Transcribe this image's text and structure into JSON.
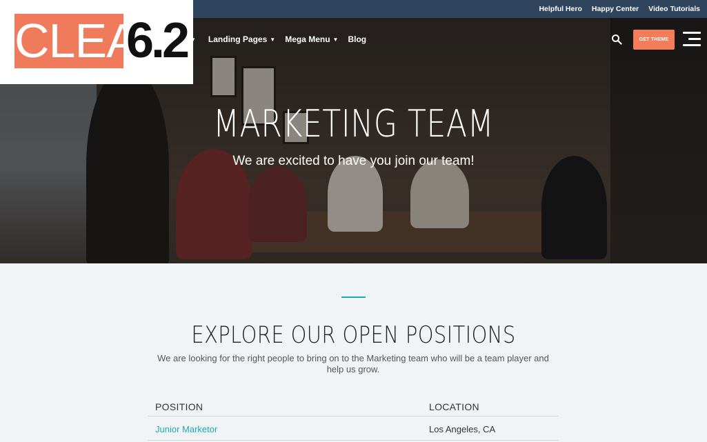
{
  "logo": {
    "word": "CLEAN",
    "version": "6.2"
  },
  "topbar": {
    "links": [
      "Helpful Hero",
      "Happy Center",
      "Video Tutorials"
    ]
  },
  "nav": {
    "items": [
      {
        "label": "Landing Pages"
      },
      {
        "label": "Mega Menu"
      },
      {
        "label": "Blog"
      }
    ],
    "cta_label": "GET THEME",
    "search_icon": "search-icon",
    "menu_icon": "hamburger-icon"
  },
  "hero": {
    "title": "MARKETING TEAM",
    "subtitle": "We are excited to have you join our team!"
  },
  "section": {
    "title": "EXPLORE OUR OPEN POSITIONS",
    "description": "We are looking for the right people to bring on to the Marketing team who will be a team player and help us grow."
  },
  "positions_table": {
    "headers": [
      "POSITION",
      "LOCATION"
    ],
    "rows": [
      {
        "position": "Junior Marketor",
        "location": "Los Angeles, CA"
      }
    ]
  },
  "colors": {
    "accent": "#f27d5b",
    "teal": "#1aa9b4",
    "topbar": "#2f445d"
  }
}
